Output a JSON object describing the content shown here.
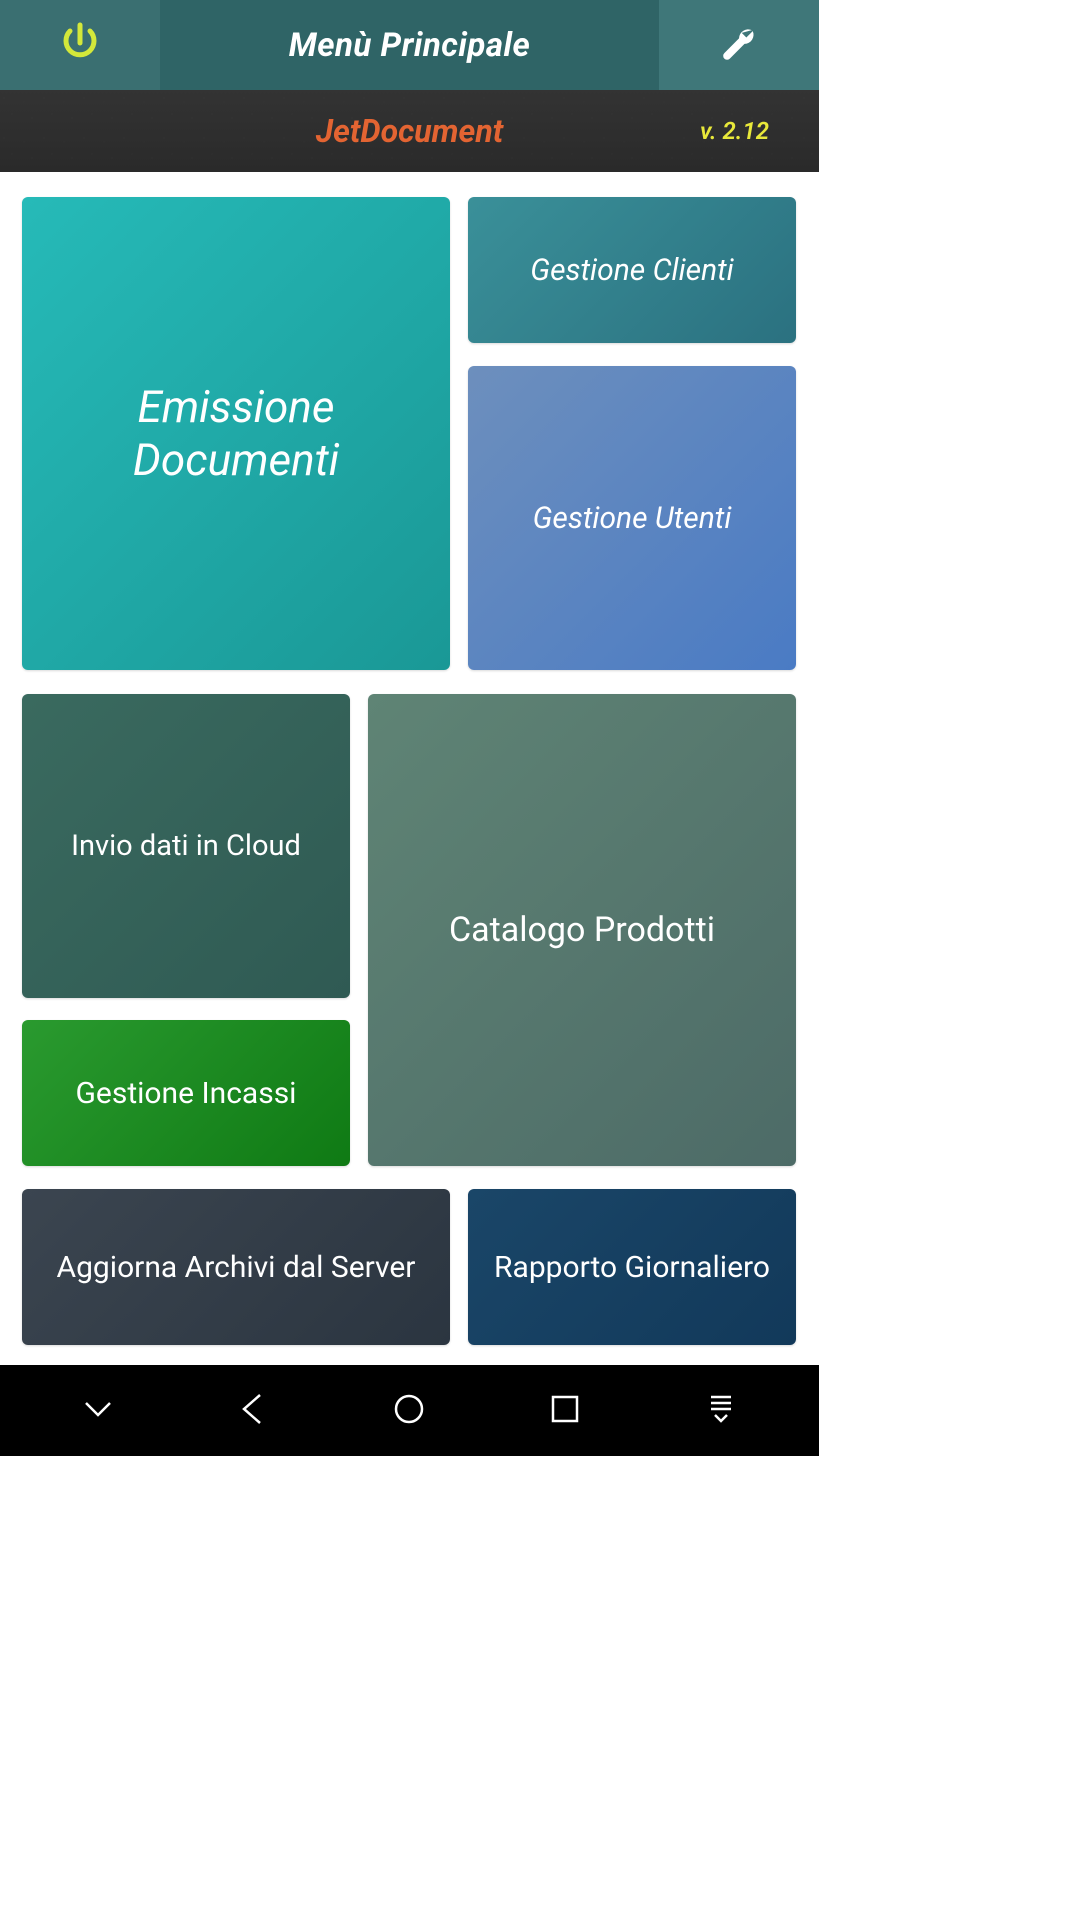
{
  "header": {
    "title": "Menù Principale"
  },
  "subheader": {
    "app_name": "JetDocument",
    "version": "v. 2.12"
  },
  "tiles": {
    "emissione": "Emissione Documenti",
    "clienti": "Gestione Clienti",
    "utenti": "Gestione Utenti",
    "cloud": "Invio dati in Cloud",
    "incassi": "Gestione Incassi",
    "catalogo": "Catalogo Prodotti",
    "aggiorna": "Aggiorna Archivi dal Server",
    "rapporto": "Rapporto Giornaliero"
  },
  "icons": {
    "power": "power-icon",
    "wrench": "wrench-icon",
    "nav_down": "chevron-down-icon",
    "nav_back": "back-icon",
    "nav_home": "home-icon",
    "nav_recent": "recent-icon",
    "nav_download": "download-icon"
  }
}
